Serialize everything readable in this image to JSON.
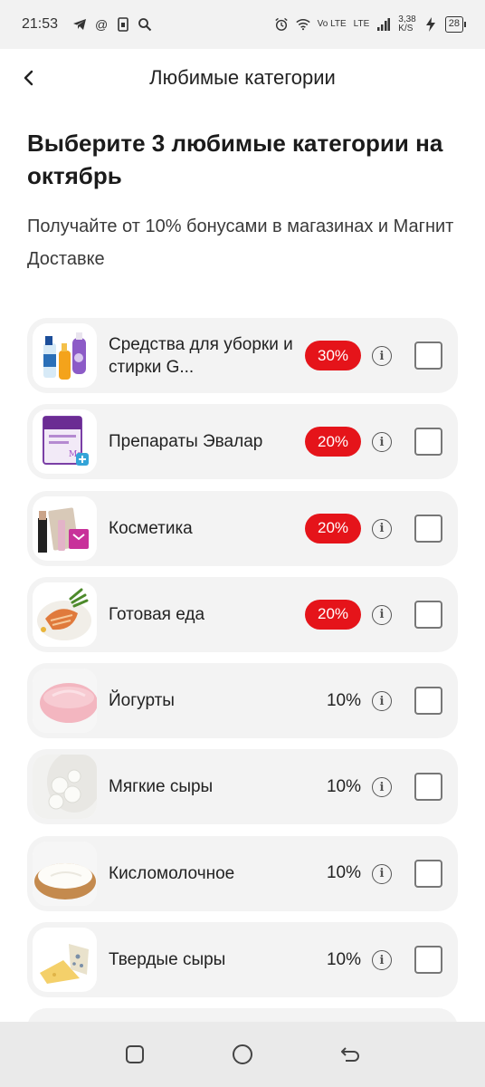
{
  "status_bar": {
    "time": "21:53",
    "network_type": "Vo LTE",
    "lte_label": "LTE",
    "speed_value": "3,38",
    "speed_unit": "K/S",
    "battery": "28",
    "icons": [
      "telegram-icon",
      "at-icon",
      "phone-icon",
      "search-icon",
      "alarm-icon",
      "wifi-icon",
      "signal-icon",
      "charging-icon"
    ]
  },
  "header": {
    "title": "Любимые категории",
    "back_icon": "chevron-left-icon"
  },
  "intro": {
    "headline": "Выберите 3 любимые категории на октябрь",
    "subline": "Получайте от 10% бонусами в магазинах и Магнит Доставке"
  },
  "categories": [
    {
      "name": "Средства для уборки и стирки G...",
      "bonus": "30%",
      "highlight": true,
      "checked": false,
      "image": "cleaning-products-image"
    },
    {
      "name": "Препараты Эвалар",
      "bonus": "20%",
      "highlight": true,
      "checked": false,
      "image": "evalar-box-image"
    },
    {
      "name": "Косметика",
      "bonus": "20%",
      "highlight": true,
      "checked": false,
      "image": "cosmetics-image"
    },
    {
      "name": "Готовая еда",
      "bonus": "20%",
      "highlight": true,
      "checked": false,
      "image": "ready-meal-image"
    },
    {
      "name": "Йогурты",
      "bonus": "10%",
      "highlight": false,
      "checked": false,
      "image": "yogurt-image"
    },
    {
      "name": "Мягкие сыры",
      "bonus": "10%",
      "highlight": false,
      "checked": false,
      "image": "mozzarella-image"
    },
    {
      "name": "Кисломолочное",
      "bonus": "10%",
      "highlight": false,
      "checked": false,
      "image": "sour-cream-image"
    },
    {
      "name": "Твердые сыры",
      "bonus": "10%",
      "highlight": false,
      "checked": false,
      "image": "hard-cheese-image"
    }
  ],
  "colors": {
    "accent": "#e5141a",
    "card_bg": "#f3f3f3"
  },
  "nav": [
    "recent-apps-icon",
    "home-icon",
    "back-icon"
  ]
}
